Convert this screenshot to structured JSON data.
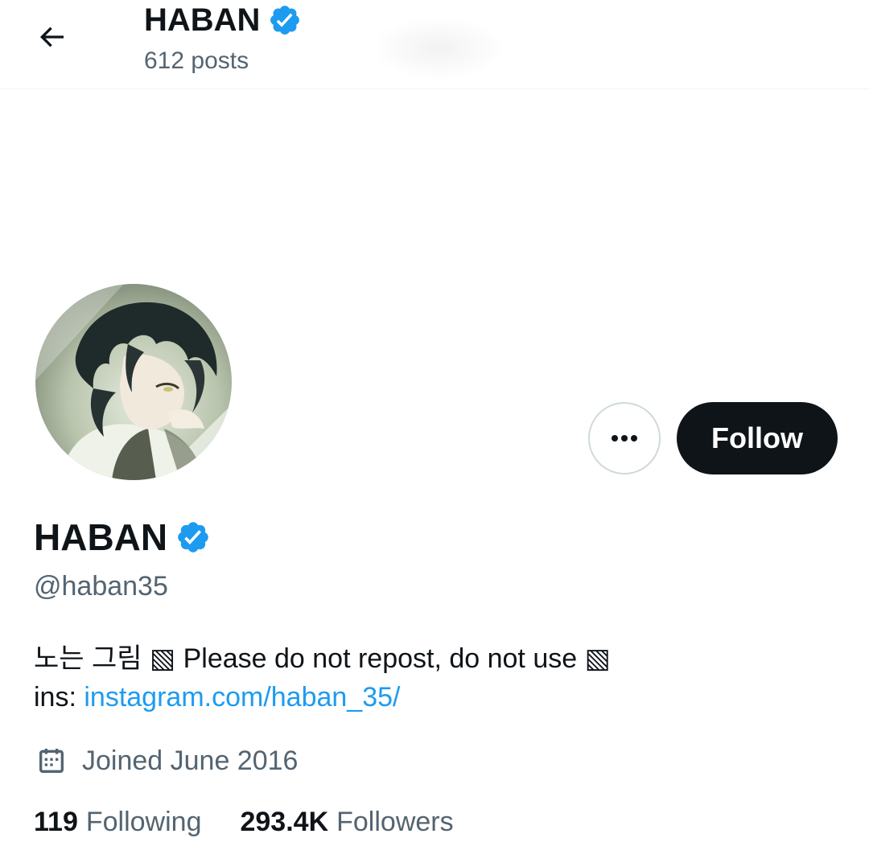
{
  "header": {
    "name": "HABAN",
    "posts_count": "612 posts",
    "back_icon": "arrow-left-icon",
    "verified_icon": "verified-badge-icon"
  },
  "profile": {
    "display_name": "HABAN",
    "handle": "@haban35",
    "bio_line1": "노는 그림 ▧ Please do not repost, do not use ▧",
    "bio_line2_prefix": "ins: ",
    "bio_link": "instagram.com/haban_35/",
    "joined": "Joined June 2016",
    "joined_icon": "calendar-icon"
  },
  "actions": {
    "more_icon": "more-options-icon",
    "follow_label": "Follow"
  },
  "stats": {
    "following_count": "119",
    "following_label": "Following",
    "followers_count": "293.4K",
    "followers_label": "Followers"
  },
  "colors": {
    "text_primary": "#0f1419",
    "text_secondary": "#536471",
    "link": "#1d9bf0",
    "verified": "#1d9bf0",
    "follow_button_bg": "#0f1419"
  }
}
